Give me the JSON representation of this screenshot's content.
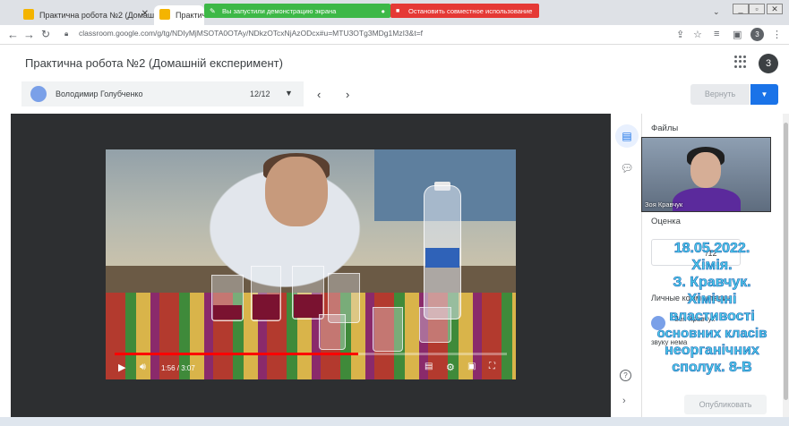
{
  "browser": {
    "tabs": [
      {
        "title": "Практична робота №2 (Домаш",
        "active": false
      },
      {
        "title": "Практична",
        "active": true
      }
    ],
    "share_notice": "Вы запустили демонстрацию экрана",
    "stop_share": "Остановить совместное использование",
    "url": "classroom.google.com/g/tg/NDIyMjMSOTA0OTAy/NDkzOTcxNjAzODcx#u=MTU3OTg3MDg1MzI3&t=f",
    "profile_initial": "3"
  },
  "header": {
    "title": "Практична робота №2 (Домашній експеримент)",
    "account_initial": "3"
  },
  "student_bar": {
    "name": "Володимир Голубченко",
    "count": "12/12"
  },
  "actions": {
    "return_label": "Вернуть"
  },
  "video": {
    "time": "1:56 / 3:07",
    "progress": 0.62
  },
  "panel": {
    "files_heading": "Файлы",
    "grade_heading": "Оценка",
    "grade_total": "/12",
    "comments_heading": "Личные комментарии",
    "comment_author": "Зоя Кравчук",
    "comment_text": "звуку нема",
    "publish_label": "Опубликовать"
  },
  "webcam": {
    "name": "Зоя Кравчук"
  },
  "overlay": {
    "line1": "18.05.2022.",
    "line2": "Хімія.",
    "line3": "З. Кравчук.",
    "line4": "Хімічні",
    "line5": "властивості",
    "line6": "основних класів",
    "line7": "неорганічних",
    "line8": "сполук. 8-В"
  },
  "colors": {
    "accent": "#1a73e8",
    "share_green": "#3db847",
    "share_red": "#e53935",
    "overlay_text": "#4fd0ee"
  }
}
